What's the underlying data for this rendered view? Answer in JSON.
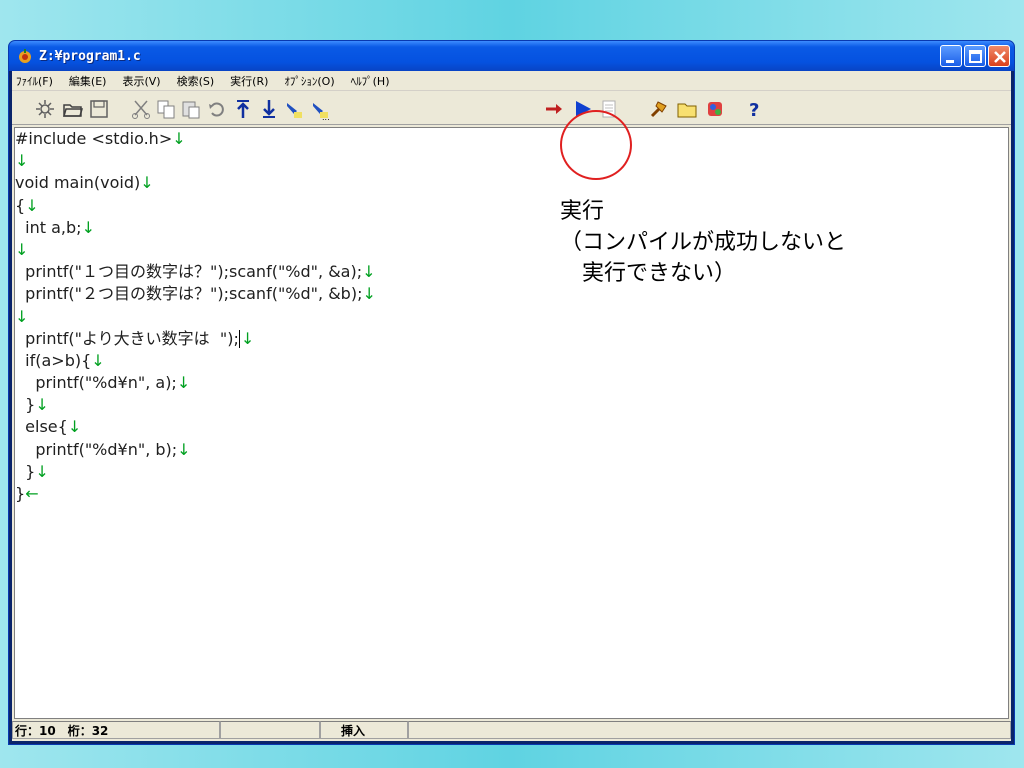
{
  "window": {
    "title": "Z:¥program1.c"
  },
  "menu": [
    "ﾌｧｲﾙ(F)",
    "編集(E)",
    "表示(V)",
    "検索(S)",
    "実行(R)",
    "ｵﾌﾟｼｮﾝ(O)",
    "ﾍﾙﾌﾟ(H)"
  ],
  "toolbar": {
    "icons": [
      "new-file-icon",
      "open-folder-icon",
      "save-icon",
      "cut-icon",
      "copy-icon",
      "paste-icon",
      "undo-icon",
      "jump-top-icon",
      "jump-bottom-icon",
      "highlight-icon",
      "highlight-more-icon",
      "compile-icon",
      "run-icon",
      "document-icon",
      "tool-icon",
      "folder-icon",
      "settings-icon",
      "help-icon"
    ]
  },
  "code": {
    "lines": [
      "#include <stdio.h>",
      "",
      "void main(void)",
      "{",
      "  int a,b;",
      "",
      "  printf(\"１つ目の数字は？\");scanf(\"%d\", &a);",
      "  printf(\"２つ目の数字は？\");scanf(\"%d\", &b);",
      "",
      "  printf(\"より大きい数字は  \");",
      "  if(a>b){",
      "    printf(\"%d¥n\", a);",
      "  }",
      "  else{",
      "    printf(\"%d¥n\", b);",
      "  }",
      "}"
    ],
    "eol_mark": "↓",
    "eof_mark": "←"
  },
  "status": {
    "position": "行：10　桁：32",
    "mode": "挿入"
  },
  "annotation": {
    "line1": "実行",
    "line2": "（コンパイルが成功しないと",
    "line3": "　実行できない）"
  }
}
